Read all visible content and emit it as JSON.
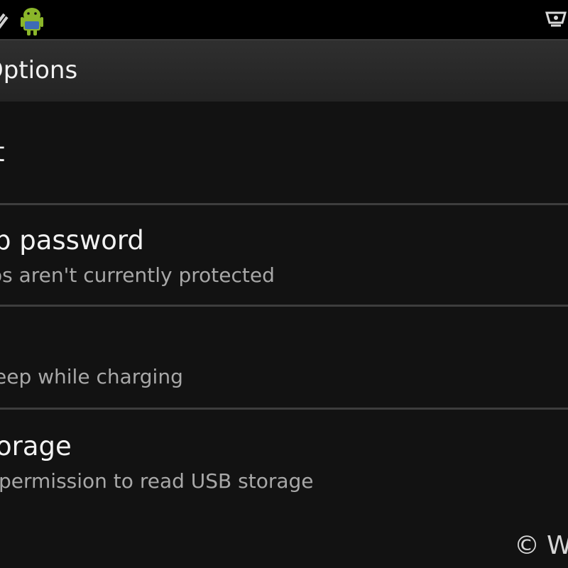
{
  "status_bar": {
    "icons": [
      "usb-icon",
      "android-debug-icon",
      "device-icon"
    ]
  },
  "action_bar": {
    "title": "Options"
  },
  "settings": [
    {
      "title": "t",
      "summary": ""
    },
    {
      "title": "p password",
      "summary": "os aren't currently protected"
    },
    {
      "title": "",
      "summary": "eep while charging"
    },
    {
      "title": "orage",
      "summary": "permission to read USB storage"
    }
  ],
  "watermark": {
    "symbol": "©",
    "text": "W"
  },
  "colors": {
    "background": "#121212",
    "action_bar": "#2a2a2a",
    "divider": "#3d3d3d",
    "android_green": "#8bb62a"
  }
}
